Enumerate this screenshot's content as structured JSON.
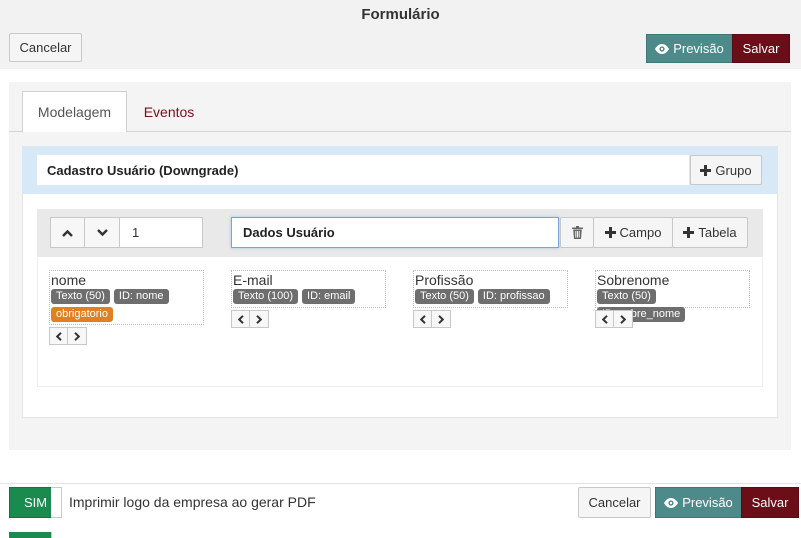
{
  "header": {
    "title": "Formulário",
    "cancel_label": "Cancelar",
    "preview_label": "Previsão",
    "save_label": "Salvar"
  },
  "tabs": [
    {
      "label": "Modelagem",
      "active": true
    },
    {
      "label": "Eventos",
      "active": false
    }
  ],
  "group": {
    "title": "Cadastro Usuário (Downgrade)",
    "add_group_label": "Grupo"
  },
  "table": {
    "order_value": "1",
    "name_value": "Dados Usuário",
    "add_field_label": "Campo",
    "add_table_label": "Tabela",
    "fields": [
      {
        "name": "nome",
        "type": "Texto (50)",
        "id": "ID: nome",
        "required": "obrigatorio"
      },
      {
        "name": "E-mail",
        "type": "Texto (100)",
        "id": "ID: email"
      },
      {
        "name": "Profissão",
        "type": "Texto (50)",
        "id": "ID: profissao"
      },
      {
        "name": "Sobrenome",
        "type": "Texto (50)",
        "id": "ID: sobre_nome"
      }
    ]
  },
  "footer": {
    "toggle_label": "SIM",
    "toggle_text": "Imprimir logo da empresa ao gerar PDF",
    "cancel_label": "Cancelar",
    "preview_label": "Previsão",
    "save_label": "Salvar"
  },
  "colors": {
    "save": "#6b0e18",
    "preview": "#4d8a8a",
    "toggle_on": "#1b8a4f",
    "required_tag": "#e08020",
    "group_header": "#d7e9f6",
    "tab_inactive_text": "#7a0e18"
  },
  "icons": {
    "preview": "eye-icon",
    "add": "plus-icon",
    "delete": "trash-icon",
    "up": "chevron-up-icon",
    "down": "chevron-down-icon",
    "left": "chevron-left-icon",
    "right": "chevron-right-icon"
  }
}
